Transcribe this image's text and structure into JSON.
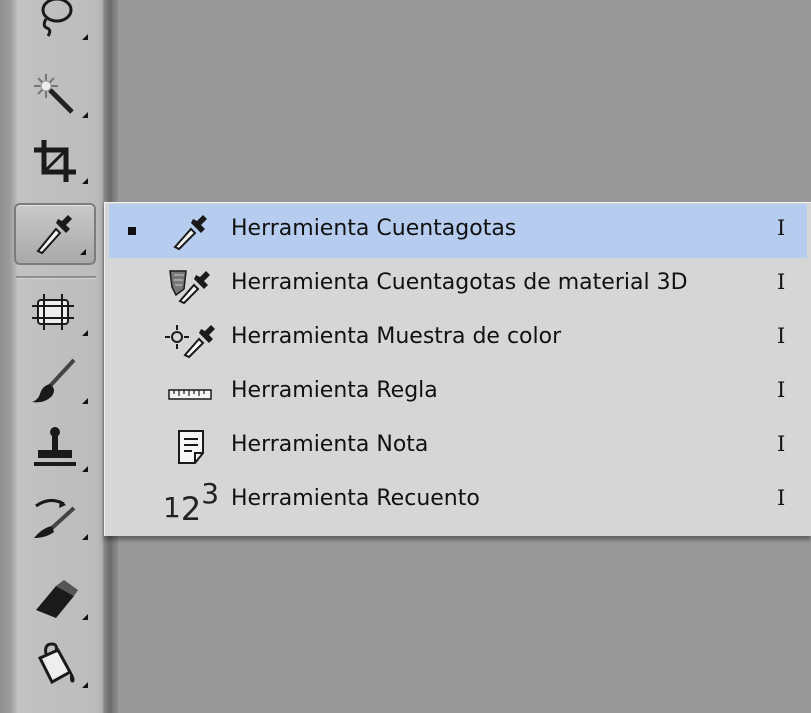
{
  "toolbar": {
    "tools": [
      {
        "name": "lasso-tool",
        "icon": "lasso-icon"
      },
      {
        "name": "magic-wand-tool",
        "icon": "magic-wand-icon"
      },
      {
        "name": "crop-tool",
        "icon": "crop-icon"
      },
      {
        "name": "eyedropper-tool",
        "icon": "eyedropper-icon",
        "active": true
      },
      {
        "name": "spot-healing-tool",
        "icon": "bandage-icon"
      },
      {
        "name": "brush-tool",
        "icon": "brush-icon"
      },
      {
        "name": "clone-stamp-tool",
        "icon": "stamp-icon"
      },
      {
        "name": "history-brush-tool",
        "icon": "history-brush-icon"
      },
      {
        "name": "eraser-tool",
        "icon": "eraser-icon"
      },
      {
        "name": "paint-bucket-tool",
        "icon": "paint-bucket-icon"
      }
    ]
  },
  "flyout": {
    "items": [
      {
        "label": "Herramienta Cuentagotas",
        "shortcut": "I",
        "icon": "eyedropper-icon",
        "selected": true
      },
      {
        "label": "Herramienta Cuentagotas de material 3D",
        "shortcut": "I",
        "icon": "material-eyedropper-icon"
      },
      {
        "label": "Herramienta Muestra de color",
        "shortcut": "I",
        "icon": "color-sampler-icon"
      },
      {
        "label": "Herramienta Regla",
        "shortcut": "I",
        "icon": "ruler-icon"
      },
      {
        "label": "Herramienta Nota",
        "shortcut": "I",
        "icon": "note-icon"
      },
      {
        "label": "Herramienta Recuento",
        "shortcut": "I",
        "icon": "count-icon"
      }
    ],
    "count_icon_text": {
      "a": "1",
      "b": "2",
      "c": "3"
    }
  },
  "colors": {
    "canvas": "#989898",
    "menu_background": "#d6d6d6",
    "selected_item": "#b6cdf0"
  }
}
